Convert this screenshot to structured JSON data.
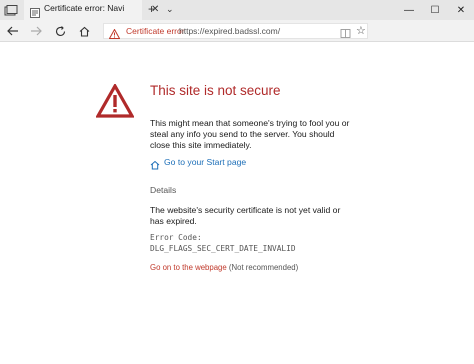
{
  "tab": {
    "title": "Certificate error: Naviga",
    "close": "✕",
    "new_tab": "+",
    "tab_list": "⌄"
  },
  "window": {
    "minimize": "—",
    "maximize": "☐",
    "close": "✕"
  },
  "address_bar": {
    "security_label": "Certificate error",
    "url": "https://expired.badssl.com/"
  },
  "content": {
    "heading": "This site is not secure",
    "description": "This might mean that someone's trying to fool you or steal any info you send to the server. You should close this site immediately.",
    "start_page_link": "Go to your Start page",
    "details_label": "Details",
    "details_text": "The website's security certificate is not yet valid or has expired.",
    "error_code_line1": "Error Code:",
    "error_code_line2": "DLG_FLAGS_SEC_CERT_DATE_INVALID",
    "go_on_link": "Go on to the webpage",
    "go_on_note": "(Not recommended)"
  },
  "colors": {
    "warning_red": "#b02a2a",
    "link_blue": "#1e6fb8",
    "tab_bar": "#e6e6e6"
  },
  "icons": [
    "tab-backdrop-icon",
    "favicon-icon",
    "back-icon",
    "forward-icon",
    "refresh-icon",
    "home-icon",
    "warning-icon",
    "reading-view-icon",
    "favorite-star-icon",
    "warning-triangle-icon",
    "start-home-icon"
  ]
}
